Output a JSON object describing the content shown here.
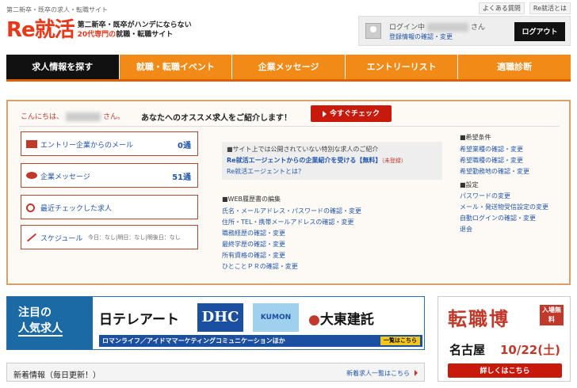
{
  "header": {
    "tagline": "第二新卒・既卒の求人・転職サイト",
    "top_links": [
      "よくある質問",
      "Re就活とは"
    ],
    "logo_text": "Re就活",
    "logo_sub_line1": "第二新卒・既卒がハンデにならない",
    "logo_sub_highlight": "20代専門の",
    "logo_sub_line2": "就職・転職サイト"
  },
  "login": {
    "status": "ログイン中",
    "suffix": "さん",
    "link": "登録情報の確認・変更",
    "logout": "ログアウト"
  },
  "nav": {
    "items": [
      "求人情報を探す",
      "就職・転職イベント",
      "企業メッセージ",
      "エントリーリスト",
      "適職診断"
    ]
  },
  "panel": {
    "greet_prefix": "こんにちは、",
    "greet_suffix": "さん。",
    "recommend": "あなたへのオススメ求人をご紹介します！",
    "check_button": "今すぐチェック",
    "side": [
      {
        "label": "エントリー企業からのメール",
        "count": "0通"
      },
      {
        "label": "企業メッセージ",
        "count": "51通"
      },
      {
        "label": "最近チェックした求人",
        "count": ""
      },
      {
        "label": "スケジュール",
        "count": ""
      }
    ],
    "schedule_days": "今日：なし|明日：なし|明後日：なし",
    "notice_t1": "■サイト上では公開されていない特別な求人のご紹介",
    "notice_t2": "Re就活エージェントからの企業紹介を受ける【無料】",
    "notice_reg": "（未登録）",
    "notice_t3": "Re就活エージェントとは？",
    "web_head": "■WEB履歴書の編集",
    "web_links": [
      "氏名・メールアドレス・パスワードの確認・変更",
      "住所・TEL・携帯メールアドレスの確認・変更",
      "職務経歴の確認・変更",
      "最終学歴の確認・変更",
      "所有資格の確認・変更",
      "ひとことＰＲの確認・変更"
    ],
    "pref_head": "■希望条件",
    "pref_links": [
      "希望業種の確認・変更",
      "希望職種の確認・変更",
      "希望勤務地の確認・変更"
    ],
    "settings_head": "■設定",
    "settings_links": [
      "パスワードの変更",
      "メール・発送物受信設定の変更",
      "自動ログインの確認・変更",
      "退会"
    ]
  },
  "banner": {
    "left_line1": "注目の",
    "left_line2": "人気求人",
    "logos": [
      "テレアート",
      "DHC",
      "KUMON",
      "大東建託"
    ],
    "bottom": "ロマンライフ／アイドママーケティングコミュニケーションほか",
    "more": "一覧はこちら"
  },
  "expo": {
    "title": "転職博",
    "free": "入場無料",
    "city": "名古屋",
    "date": "10/22(土)",
    "button": "詳しくはこちら"
  },
  "news": {
    "title": "新着情報（毎日更新！）",
    "link": "新着求人一覧はこちら"
  }
}
